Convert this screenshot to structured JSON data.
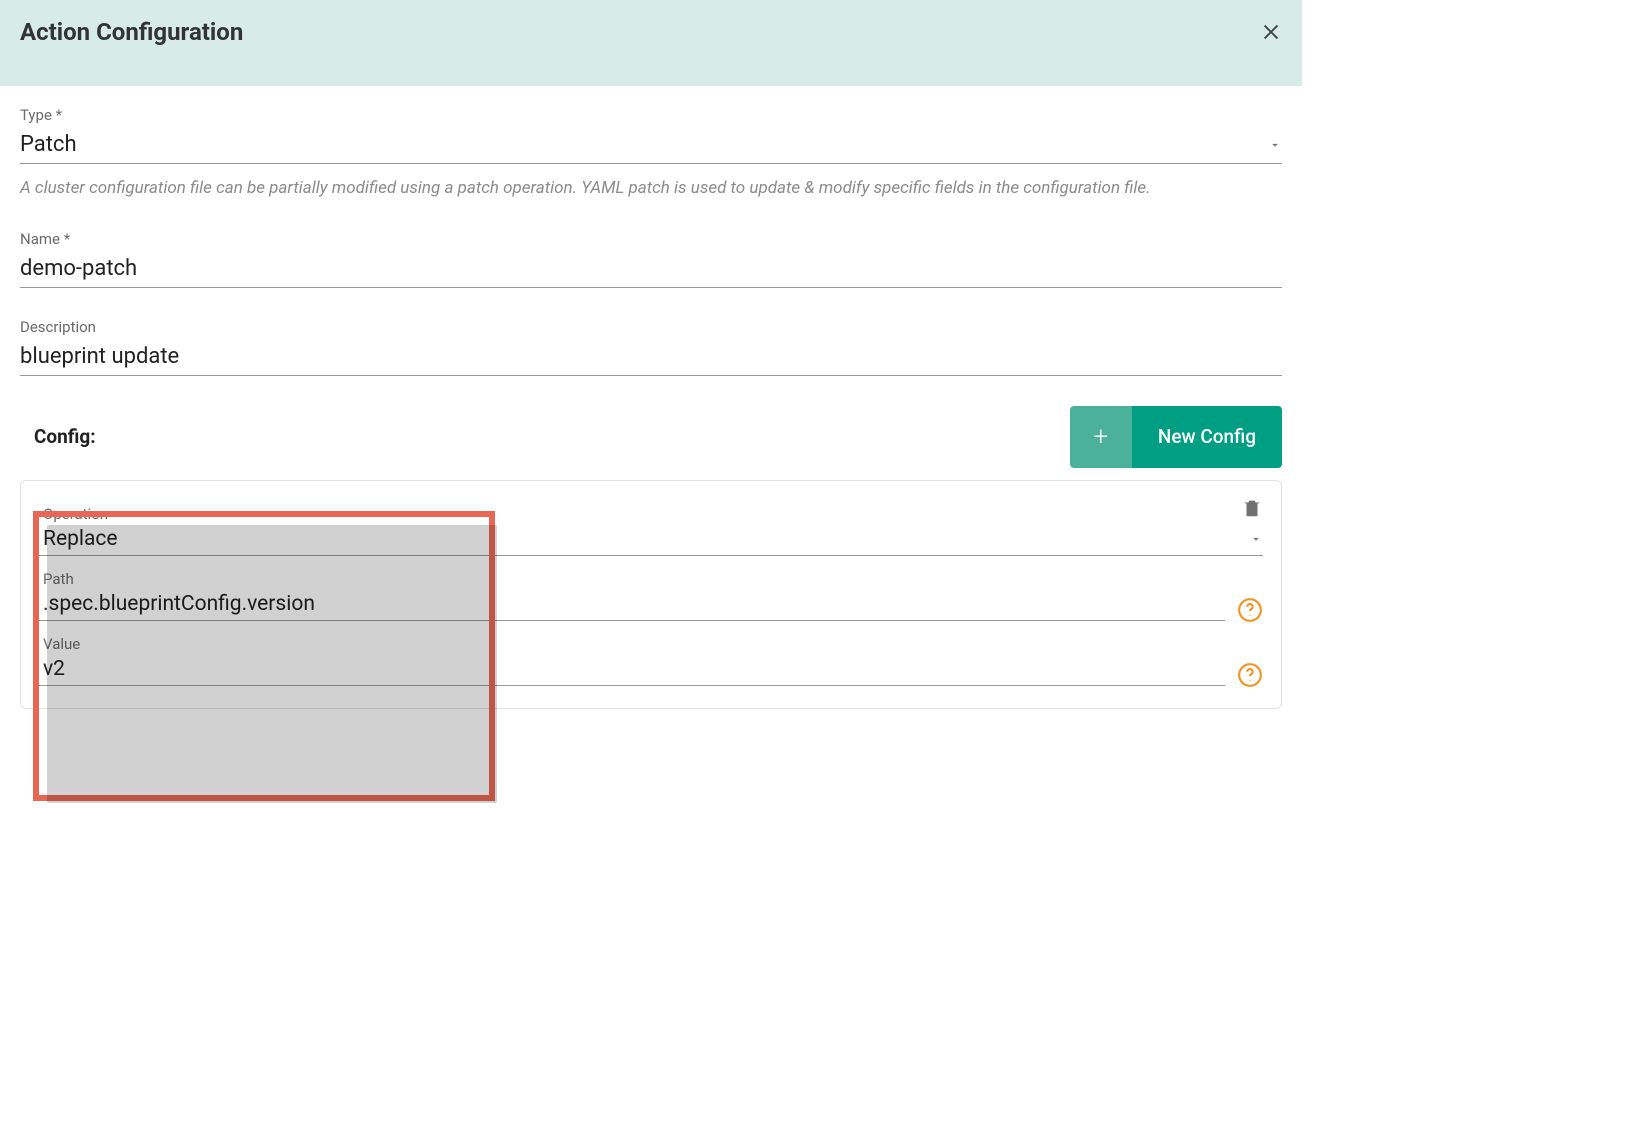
{
  "dialog": {
    "title": "Action Configuration"
  },
  "fields": {
    "type": {
      "label": "Type *",
      "value": "Patch",
      "helper": "A cluster configuration file can be partially modified using a patch operation. YAML patch is used to update & modify specific fields in the configuration file."
    },
    "name": {
      "label": "Name *",
      "value": "demo-patch"
    },
    "description": {
      "label": "Description",
      "value": "blueprint update"
    }
  },
  "config": {
    "label": "Config:",
    "newButton": "New Config",
    "card": {
      "operation": {
        "label": "Operation",
        "value": "Replace"
      },
      "path": {
        "label": "Path",
        "value": ".spec.blueprintConfig.version"
      },
      "value": {
        "label": "Value",
        "value": "v2"
      }
    }
  }
}
